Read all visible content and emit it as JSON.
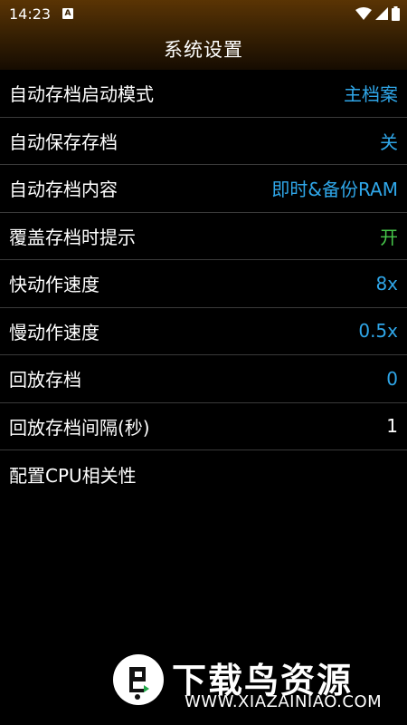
{
  "status_bar": {
    "time": "14:23",
    "notification_glyph": "A",
    "icons": [
      "wifi-icon",
      "signal-icon",
      "battery-icon"
    ]
  },
  "title": "系统设置",
  "colors": {
    "value_blue": "#2fa6e8",
    "value_green": "#46c64a",
    "value_white": "#ffffff",
    "header_top": "#5a3404",
    "divider": "#3a3a3a"
  },
  "settings": [
    {
      "label": "自动存档启动模式",
      "value": "主档案",
      "color": "#2fa6e8"
    },
    {
      "label": "自动保存存档",
      "value": "关",
      "color": "#2fa6e8"
    },
    {
      "label": "自动存档内容",
      "value": "即时&备份RAM",
      "color": "#2fa6e8"
    },
    {
      "label": "覆盖存档时提示",
      "value": "开",
      "color": "#46c64a"
    },
    {
      "label": "快动作速度",
      "value": "8x",
      "color": "#2fa6e8"
    },
    {
      "label": "慢动作速度",
      "value": "0.5x",
      "color": "#2fa6e8"
    },
    {
      "label": "回放存档",
      "value": "0",
      "color": "#2fa6e8"
    },
    {
      "label": "回放存档间隔(秒)",
      "value": "1",
      "color": "#ffffff"
    },
    {
      "label": "配置CPU相关性",
      "value": "",
      "color": "#ffffff"
    }
  ],
  "watermark": {
    "brand": "下载鸟资源",
    "url": "WWW.XIAZAINIAO.COM"
  }
}
